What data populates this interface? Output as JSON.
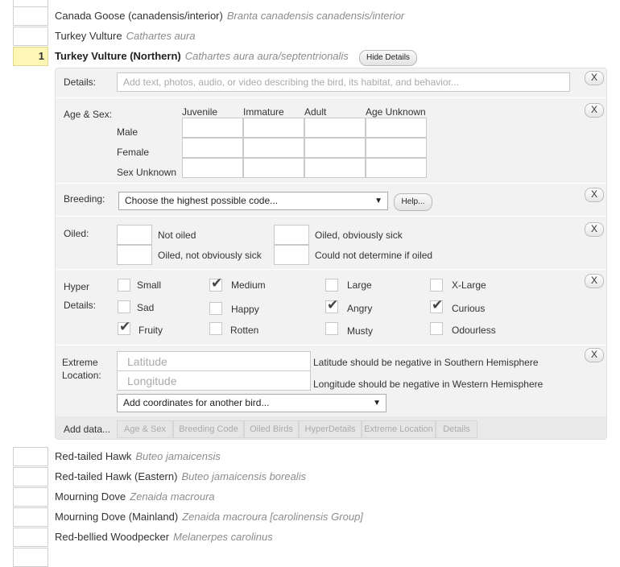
{
  "rows_above": [
    {
      "count": "",
      "common": "Canada Goose (canadensis/interior)",
      "scientific": "Branta canadensis canadensis/interior"
    },
    {
      "count": "",
      "common": "Turkey Vulture",
      "scientific": "Cathartes aura"
    }
  ],
  "active_row": {
    "count": "1",
    "common": "Turkey Vulture (Northern)",
    "scientific": "Cathartes aura aura/septentrionalis",
    "hide_label": "Hide Details"
  },
  "close_label": "X",
  "details": {
    "label": "Details:",
    "placeholder": "Add text, photos, audio, or video describing the bird, its habitat, and behavior..."
  },
  "age_sex": {
    "label": "Age & Sex:",
    "columns": [
      "Juvenile",
      "Immature",
      "Adult",
      "Age Unknown"
    ],
    "rows": [
      "Male",
      "Female",
      "Sex Unknown"
    ]
  },
  "breeding": {
    "label": "Breeding:",
    "select_value": "Choose the highest possible code...",
    "help_label": "Help..."
  },
  "oiled": {
    "label": "Oiled:",
    "options": [
      "Not oiled",
      "Oiled, not obviously sick",
      "Oiled, obviously sick",
      "Could not determine if oiled"
    ]
  },
  "hyper": {
    "label_line1": "Hyper",
    "label_line2": "Details:",
    "options": [
      {
        "label": "Small",
        "checked": false
      },
      {
        "label": "Medium",
        "checked": true
      },
      {
        "label": "Large",
        "checked": false
      },
      {
        "label": "X-Large",
        "checked": false
      },
      {
        "label": "Sad",
        "checked": false
      },
      {
        "label": "Happy",
        "checked": false
      },
      {
        "label": "Angry",
        "checked": true
      },
      {
        "label": "Curious",
        "checked": true
      },
      {
        "label": "Fruity",
        "checked": true
      },
      {
        "label": "Rotten",
        "checked": false
      },
      {
        "label": "Musty",
        "checked": false
      },
      {
        "label": "Odourless",
        "checked": false
      }
    ],
    "check_glyph": "✔"
  },
  "extreme": {
    "label_line1": "Extreme",
    "label_line2": "Location:",
    "latitude_placeholder": "Latitude",
    "longitude_placeholder": "Longitude",
    "latitude_hint": "Latitude should be negative in Southern Hemisphere",
    "longitude_hint": "Longitude should be negative in Western Hemisphere",
    "coord_select": "Add coordinates for another bird..."
  },
  "add_data": {
    "label": "Add data...",
    "tabs": [
      "Age & Sex",
      "Breeding Code",
      "Oiled Birds",
      "HyperDetails",
      "Extreme Location",
      "Details"
    ]
  },
  "rows_below": [
    {
      "count": "",
      "common": "Red-tailed Hawk",
      "scientific": "Buteo jamaicensis"
    },
    {
      "count": "",
      "common": "Red-tailed Hawk (Eastern)",
      "scientific": "Buteo jamaicensis borealis"
    },
    {
      "count": "",
      "common": "Mourning Dove",
      "scientific": "Zenaida macroura"
    },
    {
      "count": "",
      "common": "Mourning Dove (Mainland)",
      "scientific": "Zenaida macroura [carolinensis Group]"
    },
    {
      "count": "",
      "common": "Red-bellied Woodpecker",
      "scientific": "Melanerpes carolinus"
    }
  ],
  "dropdown_arrow": "▼"
}
